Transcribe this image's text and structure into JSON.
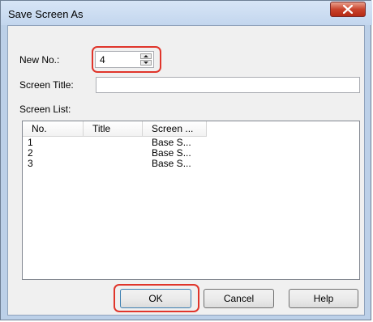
{
  "window": {
    "title": "Save Screen As",
    "close_icon": "close-x-icon"
  },
  "new_no": {
    "label": "New No.:",
    "value": "4"
  },
  "screen_title": {
    "label": "Screen Title:",
    "value": ""
  },
  "screen_list": {
    "label": "Screen List:",
    "columns": [
      "No.",
      "Title",
      "Screen ..."
    ],
    "rows": [
      {
        "no": "1",
        "title": "",
        "screen": "Base S..."
      },
      {
        "no": "2",
        "title": "",
        "screen": "Base S..."
      },
      {
        "no": "3",
        "title": "",
        "screen": "Base S..."
      }
    ]
  },
  "buttons": {
    "ok": "OK",
    "cancel": "Cancel",
    "help": "Help"
  },
  "highlight_color": "#e0352b"
}
